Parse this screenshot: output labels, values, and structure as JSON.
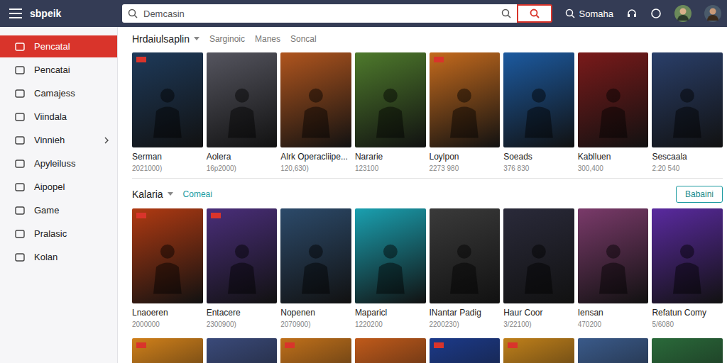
{
  "app": {
    "logo": "sbpeik"
  },
  "search": {
    "placeholder": "Demcasin"
  },
  "topbar": {
    "label": "Somaha"
  },
  "sidebar": {
    "items": [
      {
        "label": "Pencatal",
        "selected": true,
        "has_submenu": false
      },
      {
        "label": "Pencatai",
        "selected": false,
        "has_submenu": false
      },
      {
        "label": "Camajess",
        "selected": false,
        "has_submenu": false
      },
      {
        "label": "Viindala",
        "selected": false,
        "has_submenu": false
      },
      {
        "label": "Vinnieh",
        "selected": false,
        "has_submenu": true
      },
      {
        "label": "Apyleiluss",
        "selected": false,
        "has_submenu": false
      },
      {
        "label": "Aipopel",
        "selected": false,
        "has_submenu": false
      },
      {
        "label": "Game",
        "selected": false,
        "has_submenu": false
      },
      {
        "label": "Pralasic",
        "selected": false,
        "has_submenu": false
      },
      {
        "label": "Kolan",
        "selected": false,
        "has_submenu": false
      }
    ]
  },
  "sections": [
    {
      "title": "Hrdaiulsaplin",
      "tabs": [
        {
          "label": "Sarginoic",
          "selected": false
        },
        {
          "label": "Manes",
          "selected": false
        },
        {
          "label": "Soncal",
          "selected": false
        }
      ],
      "action": null,
      "cards": [
        {
          "title": "Serman",
          "count": "2021000)",
          "color": "#1e3a5a",
          "badge": true
        },
        {
          "title": "Aolera",
          "count": "16p2000)",
          "color": "#55555f",
          "badge": false
        },
        {
          "title": "Alrk Operacliipe...",
          "count": "120,630)",
          "color": "#b0551e",
          "badge": false
        },
        {
          "title": "Nararie",
          "count": "123100",
          "color": "#4e7a2c",
          "badge": false
        },
        {
          "title": "Loylpon",
          "count": "2273 980",
          "color": "#c46a1d",
          "badge": true
        },
        {
          "title": "Soeads",
          "count": "376 830",
          "color": "#1c5aa0",
          "badge": false
        },
        {
          "title": "Kablluen",
          "count": "300,400",
          "color": "#7a1a1a",
          "badge": false
        },
        {
          "title": "Sescaala",
          "count": "2:20 540",
          "color": "#2a3f6a",
          "badge": false
        }
      ]
    },
    {
      "title": "Kalaria",
      "tabs": [
        {
          "label": "Comeai",
          "selected": true
        }
      ],
      "action": "Babaini",
      "cards": [
        {
          "title": "Lnaoeren",
          "count": "2000000",
          "color": "#b03a12",
          "badge": true
        },
        {
          "title": "Entacere",
          "count": "2300900)",
          "color": "#4a2e7a",
          "badge": true
        },
        {
          "title": "Nopenen",
          "count": "2070900)",
          "color": "#2c4a6a",
          "badge": false
        },
        {
          "title": "Maparicl",
          "count": "1220200",
          "color": "#1aa0b0",
          "badge": false
        },
        {
          "title": "INantar Padig",
          "count": "2200230)",
          "color": "#3a3a3a",
          "badge": false
        },
        {
          "title": "Haur Coor",
          "count": "3/22100)",
          "color": "#2a2a3a",
          "badge": false
        },
        {
          "title": "Iensan",
          "count": "470200",
          "color": "#7a3a6a",
          "badge": false
        },
        {
          "title": "Refatun Comy",
          "count": "5/6080",
          "color": "#5a2aa0",
          "badge": false
        }
      ]
    }
  ],
  "more_covers": [
    {
      "color": "#d0801a",
      "badge": true
    },
    {
      "color": "#3a4a7a",
      "badge": false
    },
    {
      "color": "#c0701a",
      "badge": true
    },
    {
      "color": "#c05a1a",
      "badge": false
    },
    {
      "color": "#1c3a8a",
      "badge": true
    },
    {
      "color": "#c0801a",
      "badge": true
    },
    {
      "color": "#3a5a8a",
      "badge": false
    },
    {
      "color": "#2a6a3a",
      "badge": false
    }
  ]
}
